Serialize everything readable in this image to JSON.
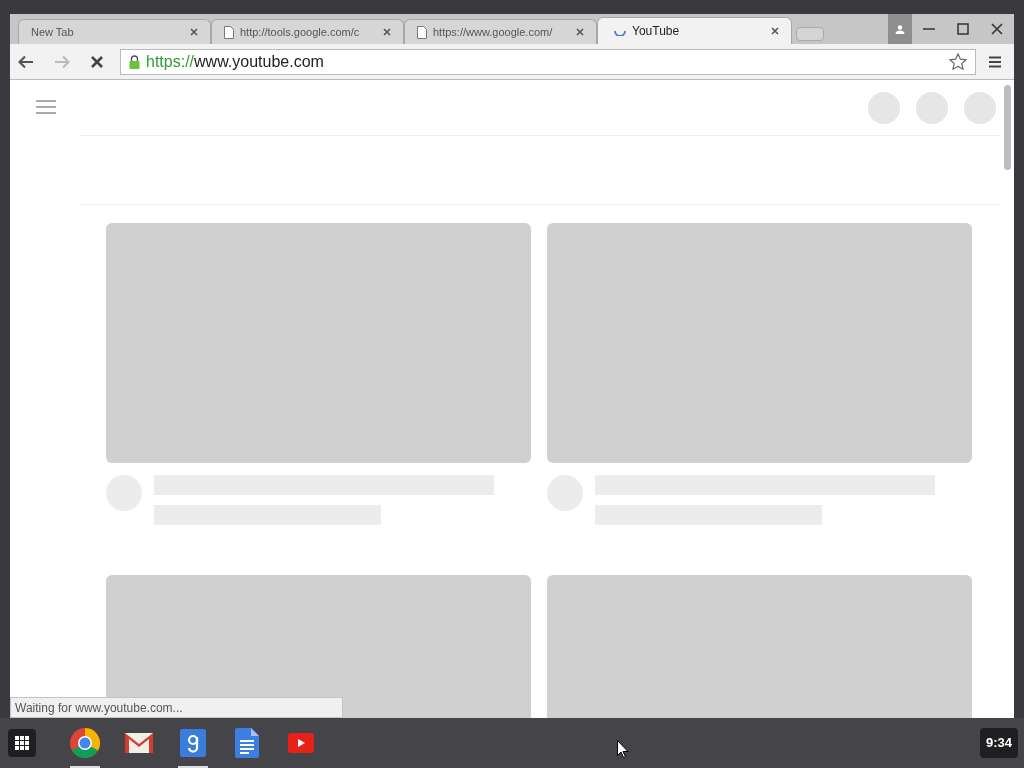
{
  "tabs": [
    {
      "label": "New Tab",
      "kind": "blank",
      "selected": false
    },
    {
      "label": "http://tools.google.com/c",
      "kind": "page",
      "selected": false
    },
    {
      "label": "https://www.google.com/",
      "kind": "page",
      "selected": false
    },
    {
      "label": "YouTube",
      "kind": "loading",
      "selected": true
    }
  ],
  "toolbar": {
    "loading": true,
    "url_scheme": "https://",
    "url_host": "www.youtube.com",
    "bookmarked": false
  },
  "status_bar": "Waiting for www.youtube.com...",
  "taskbar": {
    "apps": [
      {
        "kind": "chrome",
        "running": true
      },
      {
        "kind": "gmail",
        "running": false
      },
      {
        "kind": "google",
        "running": true
      },
      {
        "kind": "docs",
        "running": false
      },
      {
        "kind": "youtube",
        "running": false
      }
    ],
    "clock": "9:34"
  }
}
